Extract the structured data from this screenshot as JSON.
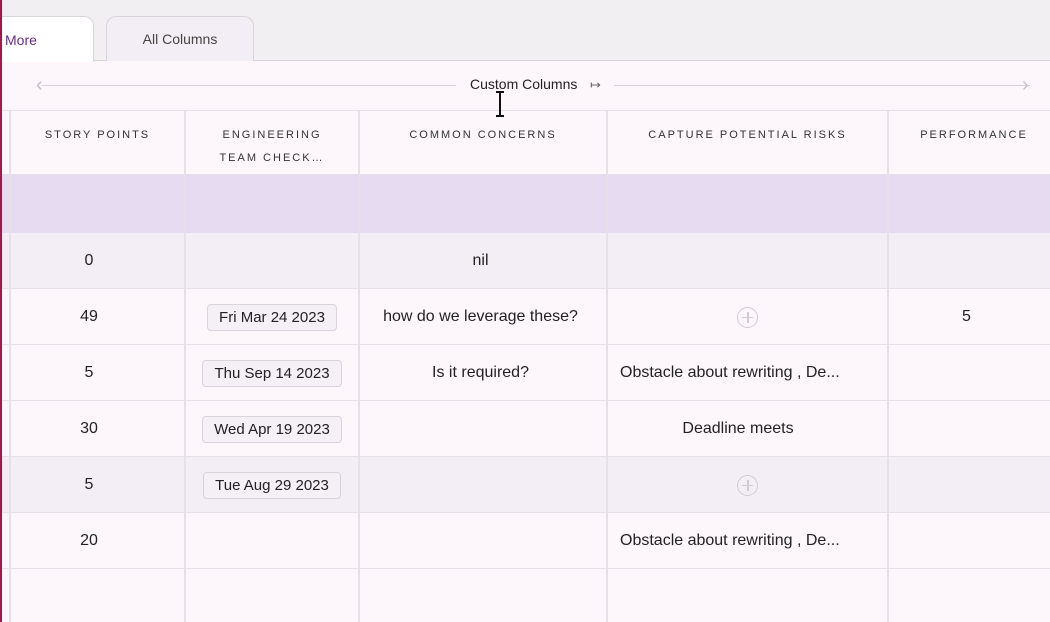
{
  "tabs": [
    {
      "label": "More"
    },
    {
      "label": "All Columns"
    }
  ],
  "group": {
    "title": "Custom Columns",
    "expand_icon": "↦"
  },
  "columns": [
    {
      "label": "STORY POINTS"
    },
    {
      "label_line1": "ENGINEERING",
      "label_line2": "TEAM CHECK…"
    },
    {
      "label": "COMMON CONCERNS"
    },
    {
      "label": "CAPTURE POTENTIAL RISKS"
    },
    {
      "label": "PERFORMANCE"
    }
  ],
  "rows": [
    {
      "story_points": "0",
      "engineering_date": "",
      "common_concerns": "nil",
      "risks": "",
      "performance": ""
    },
    {
      "story_points": "49",
      "engineering_date": "Fri Mar 24 2023",
      "common_concerns": "how do we leverage these?",
      "risks": "add-icon",
      "performance": "5"
    },
    {
      "story_points": "5",
      "engineering_date": "Thu Sep 14 2023",
      "common_concerns": "Is it required?",
      "risks": "Obstacle about rewriting , De...",
      "performance": ""
    },
    {
      "story_points": "30",
      "engineering_date": "Wed Apr 19 2023",
      "common_concerns": "",
      "risks": "Deadline meets",
      "performance": ""
    },
    {
      "story_points": "5",
      "engineering_date": "Tue Aug 29 2023",
      "common_concerns": "",
      "risks": "add-icon",
      "performance": ""
    },
    {
      "story_points": "20",
      "engineering_date": "",
      "common_concerns": "",
      "risks": "Obstacle about rewriting , De...",
      "performance": ""
    }
  ],
  "colors": {
    "accent": "#6a2a8a",
    "band": "#e6dbf0",
    "row_alt": "#f3edf6",
    "left_rule": "#9b1b4a"
  }
}
